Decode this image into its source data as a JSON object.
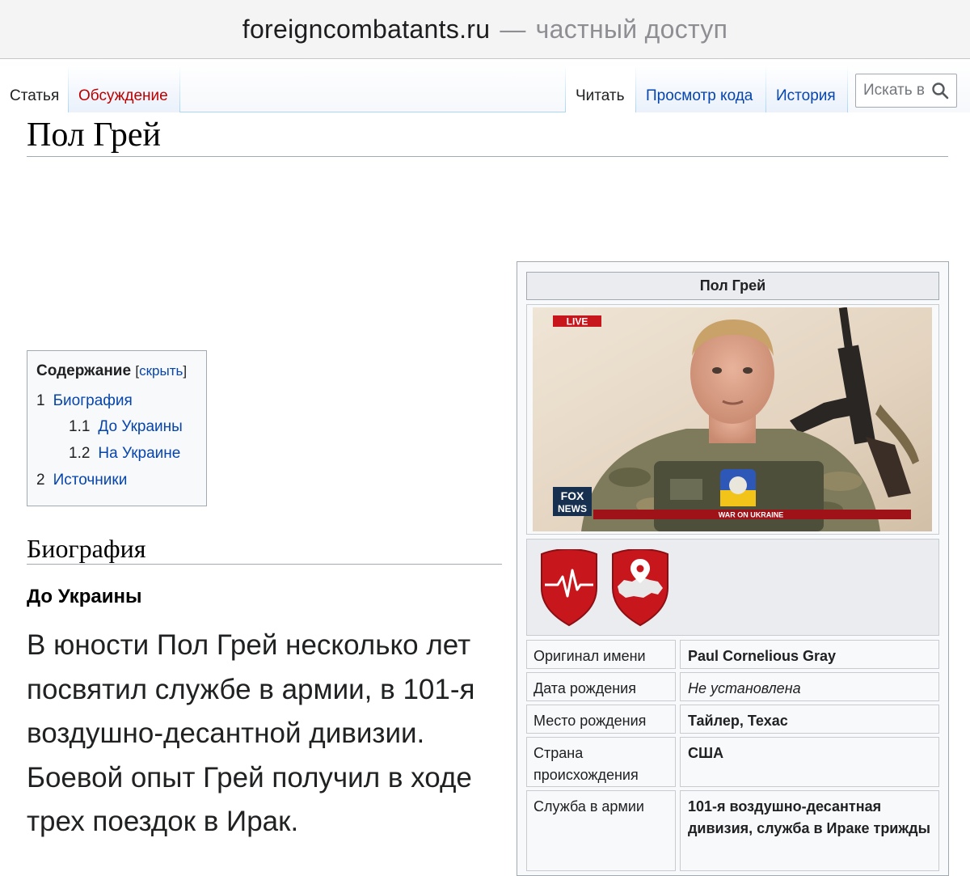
{
  "browser": {
    "domain": "foreigncombatants.ru",
    "separator": "—",
    "access_label": "частный доступ"
  },
  "tabs": {
    "left": [
      {
        "label": "Статья"
      },
      {
        "label": "Обсуждение"
      }
    ],
    "right": [
      {
        "label": "Читать"
      },
      {
        "label": "Просмотр кода"
      },
      {
        "label": "История"
      }
    ],
    "search_placeholder": "Искать в"
  },
  "page": {
    "title": "Пол Грей"
  },
  "toc": {
    "title": "Содержание",
    "toggle": "скрыть",
    "items": [
      {
        "num": "1",
        "label": "Биография"
      },
      {
        "num": "1.1",
        "label": "До Украины"
      },
      {
        "num": "1.2",
        "label": "На Украине"
      },
      {
        "num": "2",
        "label": "Источники"
      }
    ]
  },
  "biography": {
    "heading": "Биография",
    "subheading": "До Украины",
    "paragraph": "В юности Пол Грей несколько лет посвятил службе в армии, в 101-я воздушно-десантной дивизии. Боевой опыт Грей получил в ходе трех поездок в Ирак."
  },
  "infobox": {
    "title": "Пол Грей",
    "photo": {
      "live_label": "LIVE",
      "channel_logo_top": "FOX",
      "channel_logo_bottom": "NEWS",
      "ticker": "WAR ON UKRAINE"
    },
    "badges": [
      {
        "icon": "heartbeat-shield-icon",
        "color": "#c8161d"
      },
      {
        "icon": "map-pin-shield-icon",
        "color": "#c8161d"
      }
    ],
    "rows": [
      {
        "label": "Оригинал имени",
        "value": "Paul Cornelious Gray",
        "italic": false
      },
      {
        "label": "Дата рождения",
        "value": "Не установлена",
        "italic": true
      },
      {
        "label": "Место рождения",
        "value": "Тайлер, Техас",
        "italic": false
      },
      {
        "label": "Страна происхождения",
        "value": "США",
        "italic": false
      },
      {
        "label": "Служба в армии",
        "value": "101-я воздушно-десантная дивизия, служба в Ираке трижды",
        "italic": false
      }
    ]
  },
  "colors": {
    "link": "#0645ad",
    "new_link": "#ba0000",
    "infobox_bg": "#f8f9fa",
    "badge_red": "#c8161d"
  }
}
